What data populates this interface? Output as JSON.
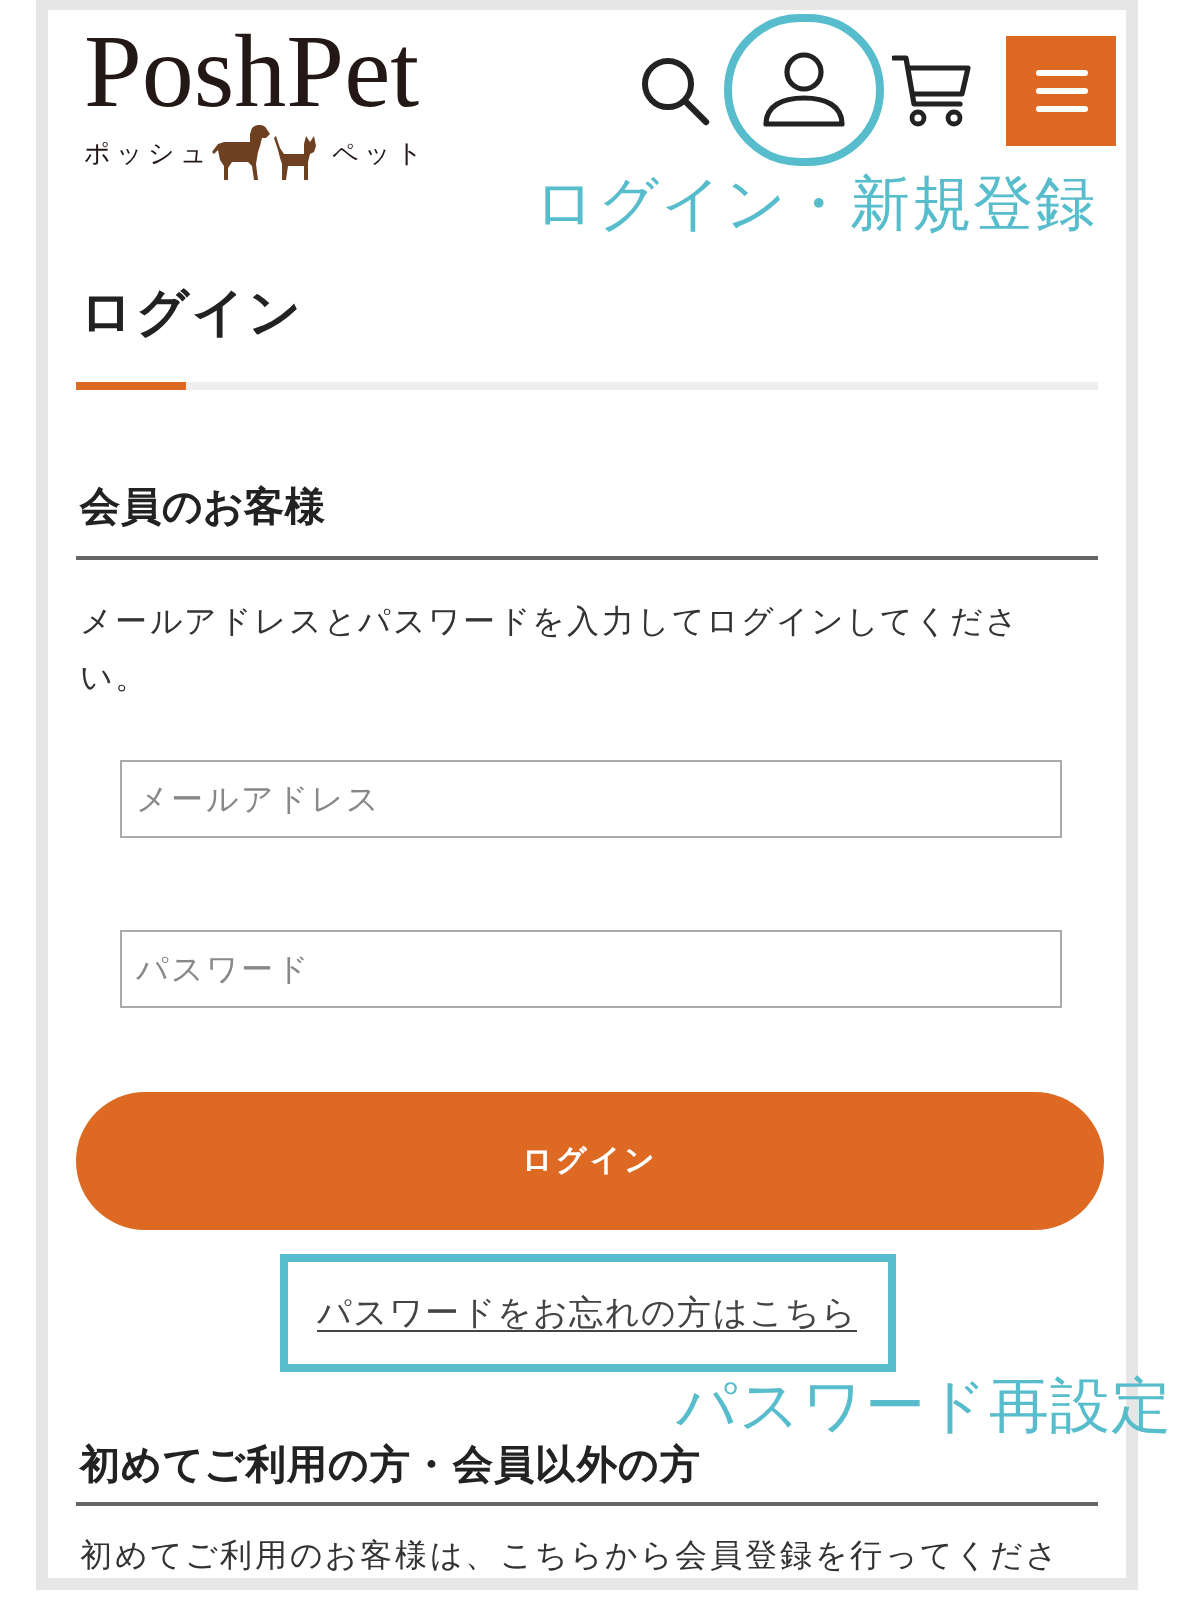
{
  "header": {
    "logo": {
      "wordmark": "PoshPet",
      "tagline_left": "ポッシュ",
      "tagline_right": "ペット"
    },
    "account_callout": "ログイン・新規登録"
  },
  "page_title": "ログイン",
  "member_section": {
    "heading": "会員のお客様",
    "instructions": "メールアドレスとパスワードを入力してログインしてください。",
    "fields": [
      {
        "placeholder": "メールアドレス"
      },
      {
        "placeholder": "パスワード"
      }
    ],
    "login_button": "ログイン",
    "forgot_password_link": "パスワードをお忘れの方はこちら",
    "forgot_password_callout": "パスワード再設定"
  },
  "guest_section": {
    "heading": "初めてご利用の方・会員以外の方",
    "text": "初めてご利用のお客様は、こちらから会員登録を行ってくださ"
  }
}
